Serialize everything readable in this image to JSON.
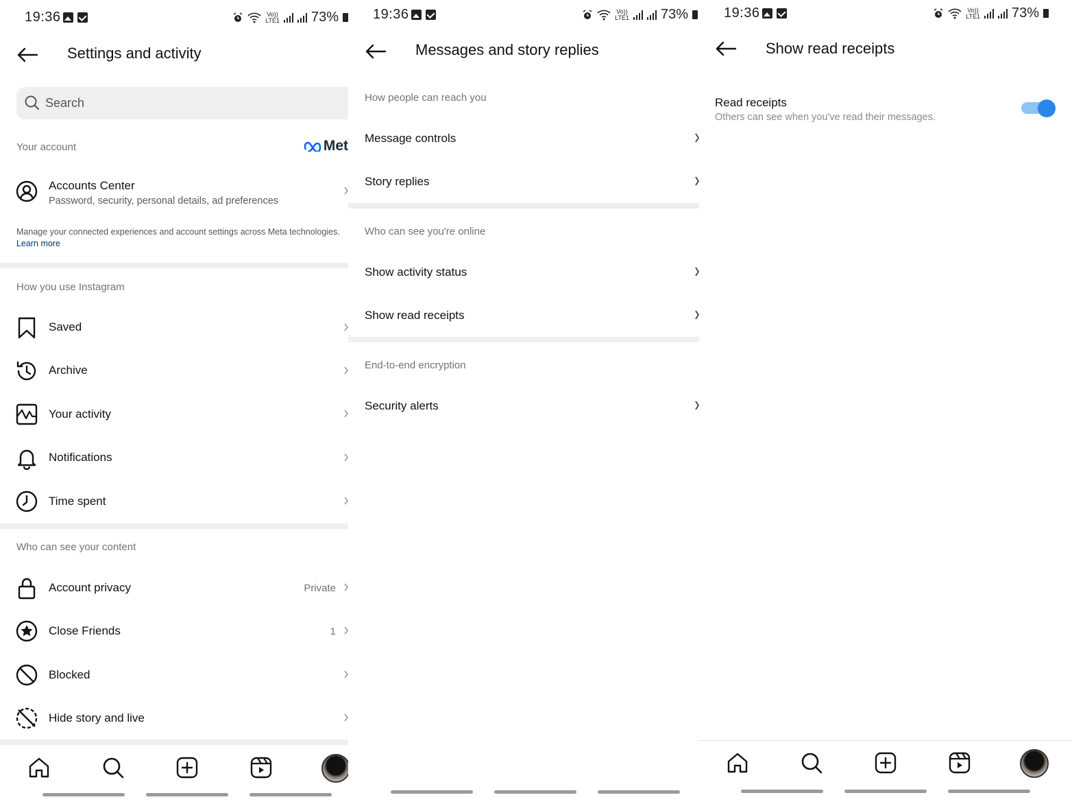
{
  "status_bar": {
    "time": "19:36",
    "battery": "73%",
    "volte_top": "Vo))",
    "volte_bottom": "LTE1",
    "signal_r": "R"
  },
  "panel1": {
    "title": "Settings and activity",
    "search_placeholder": "Search",
    "your_account_label": "Your account",
    "meta_logo_text": "Met",
    "accounts_center": {
      "title": "Accounts Center",
      "subtitle": "Password, security, personal details, ad preferences"
    },
    "note": "Manage your connected experiences and account settings across Meta technologies.",
    "learn_more": "Learn more",
    "section_usage": "How you use Instagram",
    "usage_items": [
      "Saved",
      "Archive",
      "Your activity",
      "Notifications",
      "Time spent"
    ],
    "section_content": "Who can see your content",
    "content_items": [
      {
        "label": "Account privacy",
        "value": "Private"
      },
      {
        "label": "Close Friends",
        "value": "1"
      },
      {
        "label": "Blocked",
        "value": ""
      },
      {
        "label": "Hide story and live",
        "value": ""
      }
    ]
  },
  "panel2": {
    "title": "Messages and story replies",
    "section_reach": "How people can reach you",
    "reach_items": [
      "Message controls",
      "Story replies"
    ],
    "section_online": "Who can see you're online",
    "online_items": [
      "Show activity status",
      "Show read receipts"
    ],
    "section_encryption": "End-to-end encryption",
    "encryption_items": [
      "Security alerts"
    ]
  },
  "panel3": {
    "title": "Show read receipts",
    "setting_title": "Read receipts",
    "setting_desc": "Others can see when you've read their messages.",
    "toggle_on": true
  },
  "nav": [
    "home-icon",
    "search-icon",
    "create-icon",
    "reels-icon",
    "profile-avatar"
  ],
  "colors": {
    "toggle_track": "#8fc2f5",
    "toggle_knob": "#2a86e8",
    "link": "#00376b",
    "divider": "#efefef"
  }
}
